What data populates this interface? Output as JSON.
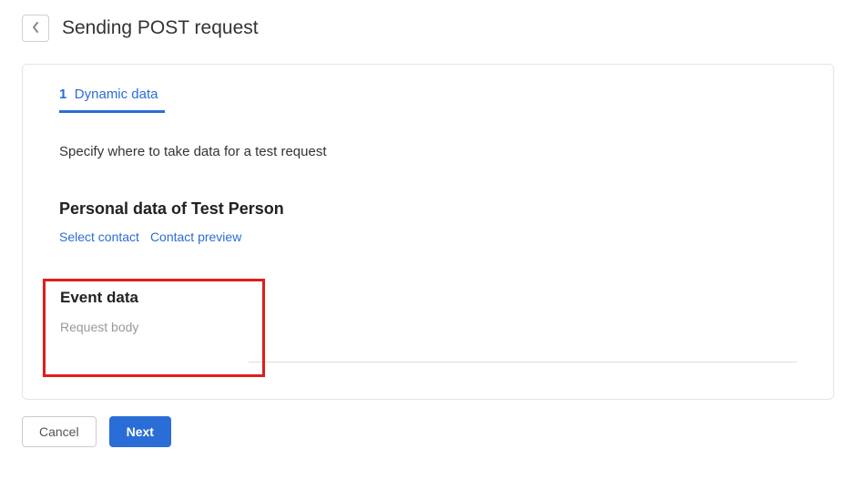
{
  "title": "Sending POST request",
  "tab": {
    "number": "1",
    "label": "Dynamic data"
  },
  "instruction": "Specify where to take data for a test request",
  "personal": {
    "heading": "Personal data of Test Person",
    "select_contact": "Select contact",
    "contact_preview": "Contact preview"
  },
  "event": {
    "heading": "Event data",
    "placeholder": "Request body"
  },
  "buttons": {
    "cancel": "Cancel",
    "next": "Next"
  }
}
